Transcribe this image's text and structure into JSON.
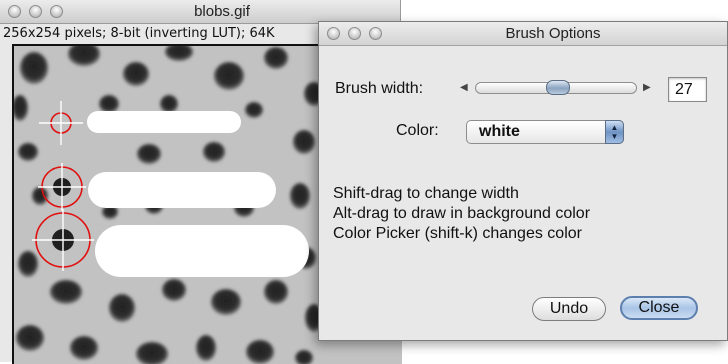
{
  "image_window": {
    "title": "blobs.gif",
    "info": "256x254 pixels; 8-bit (inverting LUT); 64K"
  },
  "dialog": {
    "title": "Brush Options",
    "brush_width_label": "Brush width:",
    "brush_width_value": "27",
    "color_label": "Color:",
    "color_value": "white",
    "help_lines": [
      "Shift-drag to change width",
      "Alt-drag to draw in background color",
      "Color Picker (shift-k) changes color"
    ],
    "undo_label": "Undo",
    "close_label": "Close"
  },
  "colors": {
    "cursor_circle": "#e01010",
    "default_button": "#a9c4e6"
  }
}
